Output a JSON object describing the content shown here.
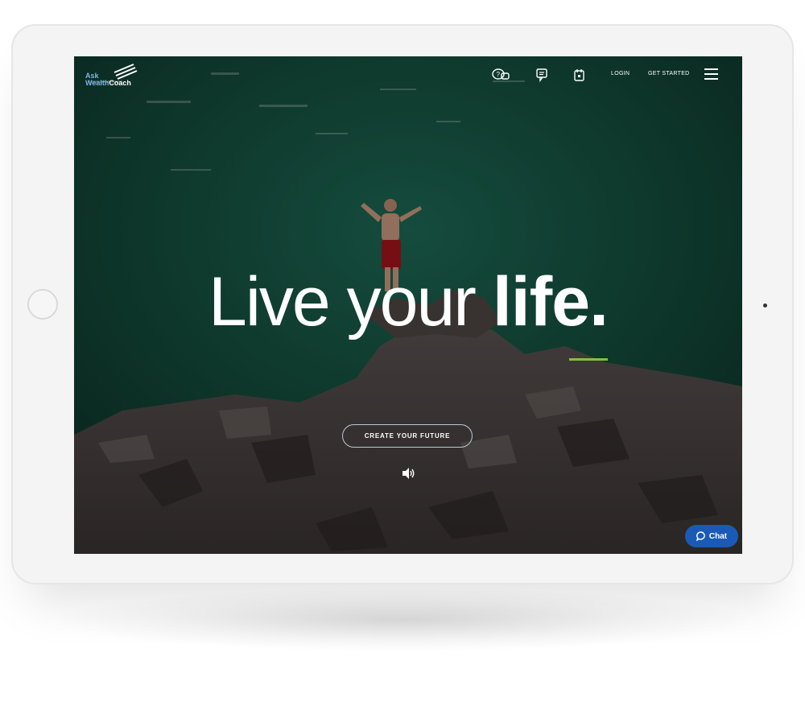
{
  "logo": {
    "line1": "Ask",
    "line2_a": "Wealth",
    "line2_b": "Coach"
  },
  "nav": {
    "icons": [
      "question-chat-icon",
      "message-icon",
      "calendar-icon"
    ],
    "login_label": "LOGIN",
    "get_started_label": "GET STARTED",
    "menu_icon": "hamburger-menu-icon"
  },
  "hero": {
    "headline_light": "Live your ",
    "headline_bold": "life.",
    "accent_color": "#7dc242",
    "cta_label": "CREATE YOUR FUTURE",
    "sound_icon": "speaker-icon"
  },
  "chat": {
    "label": "Chat",
    "color": "#1a5ab6"
  }
}
